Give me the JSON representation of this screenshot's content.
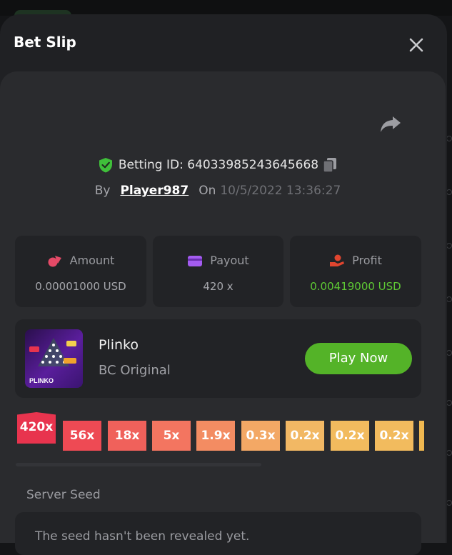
{
  "modal": {
    "title": "Bet Slip"
  },
  "bet": {
    "id_label": "Betting ID:",
    "id": "64033985243645668",
    "by_label": "By",
    "player": "Player987",
    "on_label": "On",
    "datetime": "10/5/2022 13:36:27"
  },
  "stats": [
    {
      "label": "Amount",
      "value": "0.00001000 USD",
      "icon": "bet-chips-icon",
      "icon_color": "#e54a67"
    },
    {
      "label": "Payout",
      "value": "420 x",
      "icon": "wallet-icon",
      "icon_color": "#a45cf0"
    },
    {
      "label": "Profit",
      "value": "0.00419000 USD",
      "icon": "profit-hand-icon",
      "icon_color": "#e0452f"
    }
  ],
  "game": {
    "name": "Plinko",
    "provider": "BC Original",
    "play_label": "Play Now",
    "thumb_text": "PLINKO"
  },
  "multipliers": [
    "420x",
    "56x",
    "18x",
    "5x",
    "1.9x",
    "0.3x",
    "0.2x",
    "0.2x",
    "0.2x"
  ],
  "multiplier_colors": [
    "#e8344e",
    "#ee4a54",
    "#f0615b",
    "#f37560",
    "#f38c62",
    "#f3a865",
    "#f2b864",
    "#f2bb5e",
    "#f2bb5e",
    "#f0b850"
  ],
  "seed": {
    "label": "Server Seed",
    "text": "The seed hasn't been revealed yet."
  },
  "colors": {
    "accent_green": "#54b328",
    "profit_green": "#5ec934"
  }
}
